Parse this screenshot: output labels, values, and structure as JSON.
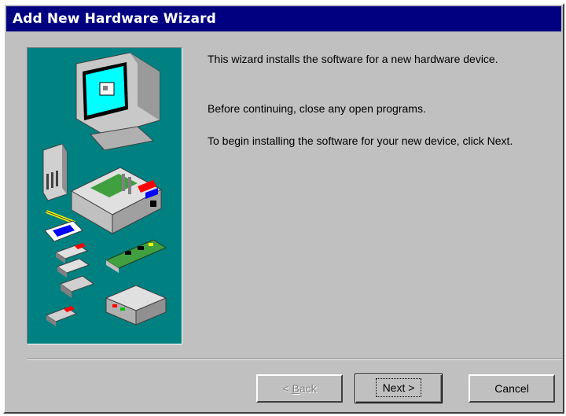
{
  "window": {
    "title": "Add New Hardware Wizard"
  },
  "content": {
    "paragraph1": "This wizard installs the software for a new hardware device.",
    "paragraph2": "Before continuing, close any open programs.",
    "paragraph3": "To begin installing the software for your new device, click Next."
  },
  "buttons": {
    "back_label_prefix": "< ",
    "back_label_mnemonic": "B",
    "back_label_rest": "ack",
    "next_label": "Next >",
    "cancel_label": "Cancel"
  },
  "illustration": {
    "icon": "hardware-devices-illustration",
    "background": "#008080"
  },
  "colors": {
    "titlebar": "#000080",
    "dialog": "#c0c0c0"
  }
}
